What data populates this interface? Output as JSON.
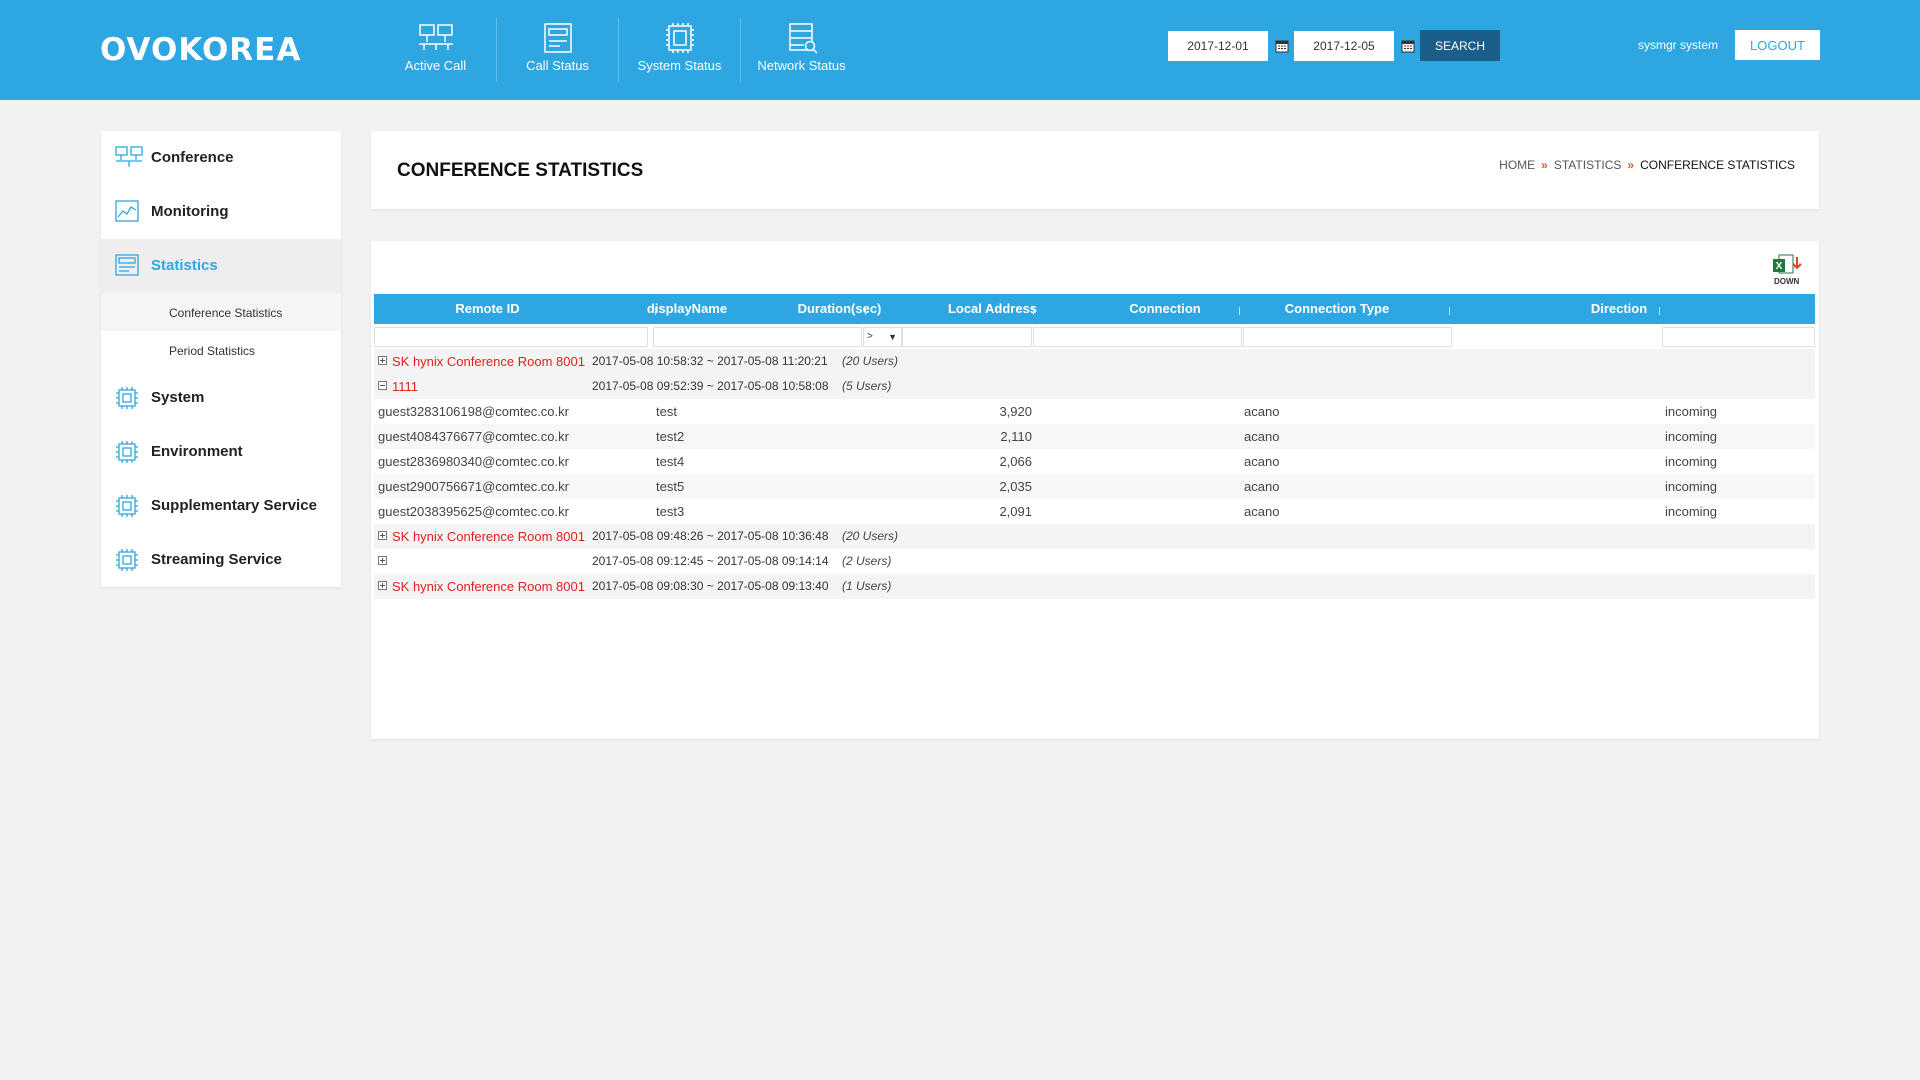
{
  "header": {
    "logo": "OVOKOREA",
    "nav": [
      {
        "label": "Active Call",
        "icon": "network-icon"
      },
      {
        "label": "Call Status",
        "icon": "call-status-icon"
      },
      {
        "label": "System Status",
        "icon": "chip-icon"
      },
      {
        "label": "Network Status",
        "icon": "network-search-icon"
      }
    ],
    "date_from": "2017-12-01",
    "date_to": "2017-12-05",
    "search_label": "SEARCH",
    "user": "sysmgr system",
    "logout_label": "LOGOUT"
  },
  "sidebar": {
    "items": [
      {
        "label": "Conference",
        "icon": "conference-icon"
      },
      {
        "label": "Monitoring",
        "icon": "monitoring-chart-icon"
      },
      {
        "label": "Statistics",
        "icon": "statistics-icon",
        "active": true
      },
      {
        "label": "System",
        "icon": "chip-icon"
      },
      {
        "label": "Environment",
        "icon": "chip-icon"
      },
      {
        "label": "Supplementary Service",
        "icon": "chip-icon"
      },
      {
        "label": "Streaming Service",
        "icon": "chip-icon"
      }
    ],
    "sub_items": [
      {
        "label": "Conference Statistics",
        "active": true
      },
      {
        "label": "Period Statistics"
      }
    ]
  },
  "page": {
    "title": "CONFERENCE STATISTICS",
    "breadcrumb": [
      "HOME",
      "STATISTICS",
      "CONFERENCE STATISTICS"
    ],
    "excel_label": "DOWN"
  },
  "grid": {
    "columns": [
      "Remote ID",
      "displayName",
      "Duration(sec)",
      "Local Address",
      "Connection",
      "Connection Type",
      "Direction"
    ],
    "duration_operator": ">",
    "groups": [
      {
        "name": "SK hynix Conference Room 8001",
        "time": "2017-05-08 10:58:32 ~ 2017-05-08 11:20:21",
        "users": "(20 Users)",
        "expanded": false,
        "rows": []
      },
      {
        "name": "1111",
        "time": "2017-05-08 09:52:39 ~ 2017-05-08 10:58:08",
        "users": "(5 Users)",
        "expanded": true,
        "rows": [
          {
            "remote_id": "guest3283106198@comtec.co.kr",
            "display": "test",
            "duration": "3,920",
            "local": "",
            "connection": "acano",
            "type": "",
            "direction": "incoming"
          },
          {
            "remote_id": "guest4084376677@comtec.co.kr",
            "display": "test2",
            "duration": "2,110",
            "local": "",
            "connection": "acano",
            "type": "",
            "direction": "incoming"
          },
          {
            "remote_id": "guest2836980340@comtec.co.kr",
            "display": "test4",
            "duration": "2,066",
            "local": "",
            "connection": "acano",
            "type": "",
            "direction": "incoming"
          },
          {
            "remote_id": "guest2900756671@comtec.co.kr",
            "display": "test5",
            "duration": "2,035",
            "local": "",
            "connection": "acano",
            "type": "",
            "direction": "incoming"
          },
          {
            "remote_id": "guest2038395625@comtec.co.kr",
            "display": "test3",
            "duration": "2,091",
            "local": "",
            "connection": "acano",
            "type": "",
            "direction": "incoming"
          }
        ]
      },
      {
        "name": "SK hynix Conference Room 8001",
        "time": "2017-05-08 09:48:26 ~ 2017-05-08 10:36:48",
        "users": "(20 Users)",
        "expanded": false,
        "rows": []
      },
      {
        "name": "",
        "time": "2017-05-08 09:12:45 ~ 2017-05-08 09:14:14",
        "users": "(2 Users)",
        "expanded": false,
        "rows": []
      },
      {
        "name": "SK hynix Conference Room 8001",
        "time": "2017-05-08 09:08:30 ~ 2017-05-08 09:13:40",
        "users": "(1 Users)",
        "expanded": false,
        "rows": []
      }
    ]
  },
  "colors": {
    "header_bg": "#2ea6e1",
    "accent": "#2ea6e1",
    "group_name": "#e02020",
    "search_bg": "#1b5e8a"
  }
}
